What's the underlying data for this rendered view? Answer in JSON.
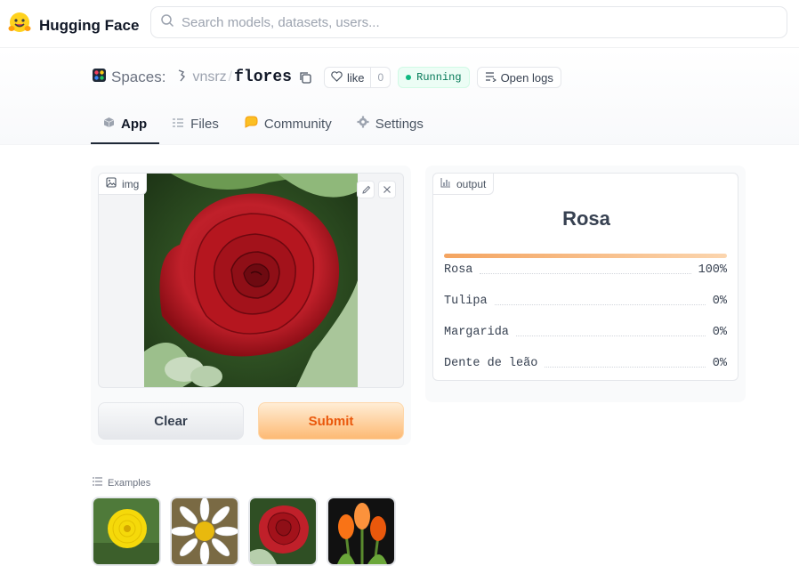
{
  "topbar": {
    "brand": "Hugging Face",
    "search_placeholder": "Search models, datasets, users..."
  },
  "space": {
    "section_label": "Spaces:",
    "owner": "vnsrz",
    "separator": "/",
    "name": "flores",
    "like_label": "like",
    "like_count": "0",
    "status": "Running",
    "logs_label": "Open logs"
  },
  "tabs": [
    {
      "label": "App",
      "icon": "cube-icon",
      "active": true
    },
    {
      "label": "Files",
      "icon": "files-icon",
      "active": false
    },
    {
      "label": "Community",
      "icon": "community-icon",
      "active": false
    },
    {
      "label": "Settings",
      "icon": "gear-icon",
      "active": false
    }
  ],
  "input": {
    "label": "img",
    "clear_label": "Clear",
    "submit_label": "Submit"
  },
  "output": {
    "label": "output",
    "top_label": "Rosa",
    "top_confidence": 1.0,
    "confidences": [
      {
        "label": "Rosa",
        "value": "100%"
      },
      {
        "label": "Tulipa",
        "value": "0%"
      },
      {
        "label": "Margarida",
        "value": "0%"
      },
      {
        "label": "Dente de leão",
        "value": "0%"
      }
    ]
  },
  "examples": {
    "label": "Examples",
    "items": [
      "dandelion",
      "daisy",
      "rose",
      "tulips"
    ]
  },
  "colors": {
    "accent": "#ea580c",
    "running": "#047857",
    "bar": "#f4a460"
  }
}
